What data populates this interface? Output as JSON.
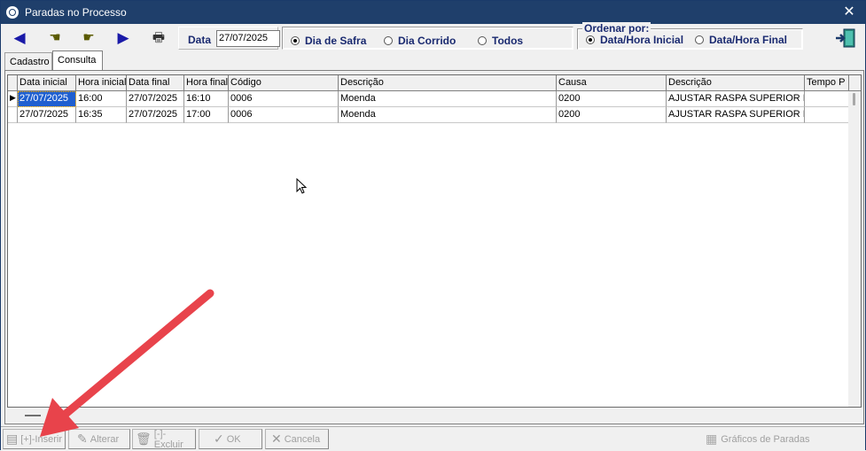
{
  "window": {
    "title": "Paradas no Processo"
  },
  "toolbar": {
    "date_label": "Data",
    "date_value": "27/07/2025",
    "radios": [
      {
        "label": "Dia de Safra",
        "selected": true
      },
      {
        "label": "Dia Corrido",
        "selected": false
      },
      {
        "label": "Todos",
        "selected": false
      }
    ],
    "order_legend": "Ordenar por:",
    "order_radios": [
      {
        "label": "Data/Hora Inicial",
        "selected": true
      },
      {
        "label": "Data/Hora Final",
        "selected": false
      }
    ]
  },
  "tabs": [
    {
      "label": "Cadastro",
      "active": false
    },
    {
      "label": "Consulta",
      "active": true
    }
  ],
  "grid": {
    "headers": [
      "Data inicial",
      "Hora inicial",
      "Data final",
      "Hora final",
      "Código",
      "Descrição",
      "Causa",
      "Descrição",
      "Tempo P"
    ],
    "rows": [
      [
        "27/07/2025",
        "16:00",
        "27/07/2025",
        "16:10",
        "0006",
        "Moenda",
        "0200",
        "AJUSTAR RASPA SUPERIOR I",
        ""
      ],
      [
        "27/07/2025",
        "16:35",
        "27/07/2025",
        "17:00",
        "0006",
        "Moenda",
        "0200",
        "AJUSTAR RASPA SUPERIOR I",
        ""
      ]
    ]
  },
  "bottom": {
    "inserir": "[+]-Inserir",
    "alterar": "Alterar",
    "excluir": "[-]-Excluir",
    "ok": "OK",
    "cancela": "Cancela",
    "graficos": "Gráficos de Paradas"
  },
  "colors": {
    "titlebar": "#1f3f6b",
    "selection": "#1e5fd0",
    "annotation_arrow": "#e8434b"
  }
}
